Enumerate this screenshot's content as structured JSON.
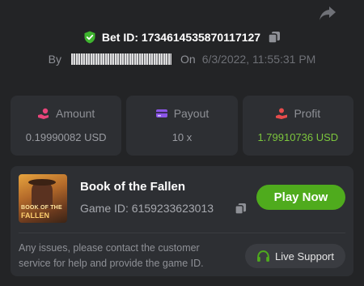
{
  "bet": {
    "label": "Bet ID:",
    "id": "1734614535870117127",
    "by_label": "By",
    "on_label": "On",
    "date": "6/3/2022, 11:55:31 PM"
  },
  "stats": [
    {
      "label": "Amount",
      "value": "0.19990082 USD",
      "icon": "coins-hand-icon"
    },
    {
      "label": "Payout",
      "value": "10 x",
      "icon": "wallet-card-icon"
    },
    {
      "label": "Profit",
      "value": "1.79910736 USD",
      "icon": "profit-hand-icon"
    }
  ],
  "game": {
    "title": "Book of the Fallen",
    "id_label": "Game ID:",
    "id": "6159233623013",
    "play_label": "Play Now",
    "thumb_line1": "BOOK OF THE",
    "thumb_line2": "FALLEN"
  },
  "support": {
    "text": "Any issues, please contact the customer service for help and provide the game ID.",
    "button_label": "Live Support"
  },
  "colors": {
    "background": "#232426",
    "card": "#2d2f33",
    "green": "#4fab1d",
    "profit": "#7cc53d"
  }
}
